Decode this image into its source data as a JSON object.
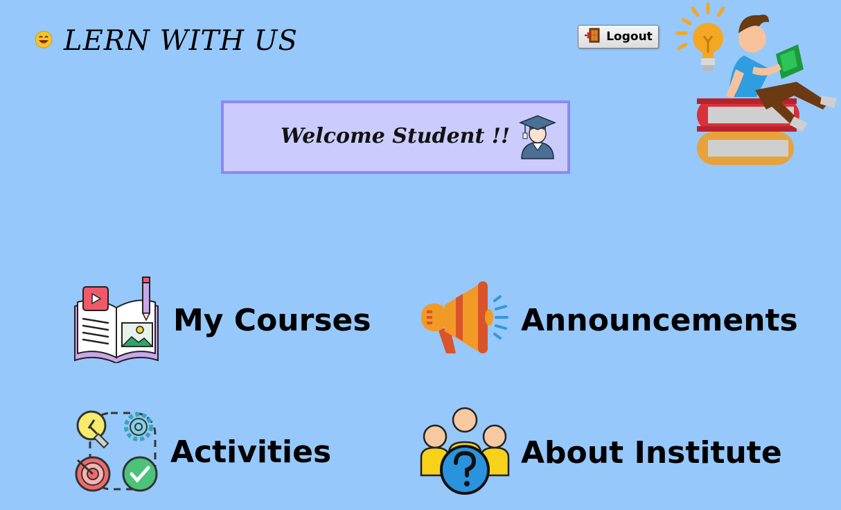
{
  "app": {
    "title": "LERN WITH US",
    "title_icon": "grinning-face-icon"
  },
  "header": {
    "logout_label": "Logout",
    "logout_icon": "door-exit-icon"
  },
  "welcome": {
    "message": "Welcome Student !!",
    "icon": "graduate-student-icon"
  },
  "menu": {
    "my_courses": {
      "label": "My Courses",
      "icon": "course-book-icon"
    },
    "announcements": {
      "label": "Announcements",
      "icon": "megaphone-icon"
    },
    "activities": {
      "label": "Activities",
      "icon": "activities-icon"
    },
    "about_institute": {
      "label": "About Institute",
      "icon": "group-question-icon"
    }
  },
  "colors": {
    "background": "#96c8fb",
    "welcome_fill": "#cccbfd",
    "welcome_border": "#8c88f6"
  }
}
